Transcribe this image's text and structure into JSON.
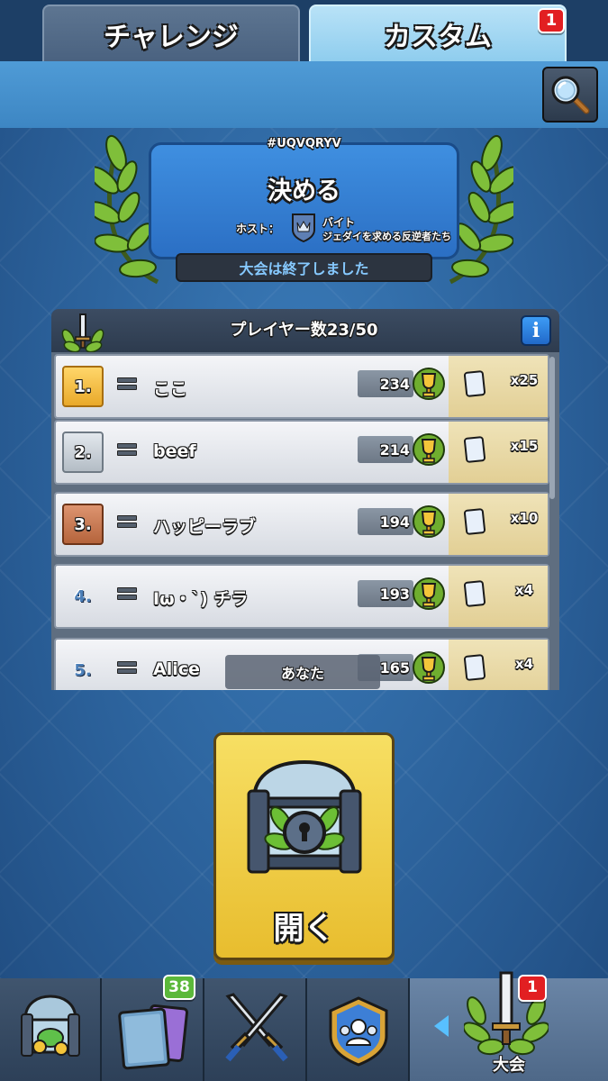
{
  "tabs": {
    "challenge_label": "チャレンジ",
    "custom_label": "カスタム",
    "custom_badge": "1"
  },
  "tournament": {
    "tag": "#UQVQRYV",
    "title": "決める",
    "host_label": "ホスト：",
    "host_name": "バイト",
    "host_clan": "ジェダイを求める反逆者たち",
    "status": "大会は終了しました"
  },
  "player_list": {
    "header": "プレイヤー数23/50",
    "info_label": "i",
    "you_label": "あなた",
    "rows": [
      {
        "rank": "1.",
        "name": "ここ",
        "score": "234",
        "reward": "x25"
      },
      {
        "rank": "2.",
        "name": "beef",
        "score": "214",
        "reward": "x15"
      },
      {
        "rank": "3.",
        "name": "ハッピーラブ",
        "score": "194",
        "reward": "x10"
      },
      {
        "rank": "4.",
        "name": "Iω・`) チラ",
        "score": "193",
        "reward": "x4"
      },
      {
        "rank": "5.",
        "name": "Alice",
        "score": "165",
        "reward": "x4"
      }
    ]
  },
  "open_button": {
    "label": "開く"
  },
  "bottom_nav": {
    "cards_badge": "38",
    "tournament_badge": "1",
    "tournament_label": "大会"
  },
  "colors": {
    "gold_rank": "#f2c24a",
    "silver_rank": "#c5cdd4",
    "bronze_rank": "#c77d58",
    "accent_blue": "#3d86c3"
  }
}
